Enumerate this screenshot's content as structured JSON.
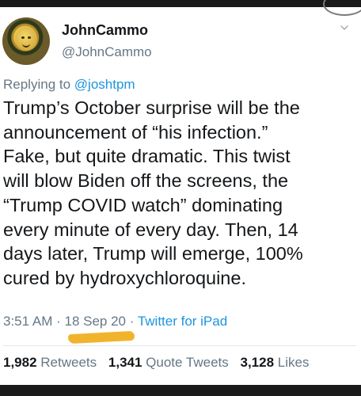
{
  "author": {
    "display_name": "JohnCammo",
    "handle": "@JohnCammo"
  },
  "reply": {
    "prefix": "Replying to",
    "to": "@joshtpm"
  },
  "tweet": {
    "text": "Trump’s October surprise will be the\nannouncement of “his infection.”\nFake, but quite dramatic. This twist\nwill blow Biden off the screens, the\n“Trump COVID watch” dominating\nevery minute of every day.  Then, 14\ndays later, Trump will emerge, 100%\ncured by hydroxychloroquine."
  },
  "meta": {
    "time": "3:51 AM",
    "sep1": " · ",
    "date": "18 Sep 20",
    "sep2": " · ",
    "source": "Twitter for iPad"
  },
  "stats": {
    "retweets_count": "1,982",
    "retweets_label": "Retweets",
    "quotes_count": "1,341",
    "quotes_label": "Quote Tweets",
    "likes_count": "3,128",
    "likes_label": "Likes"
  },
  "colors": {
    "link": "#1b95e0",
    "muted": "#657786",
    "highlight": "#f2b32c"
  },
  "icons": {
    "chevron": "chevron-down-icon"
  }
}
